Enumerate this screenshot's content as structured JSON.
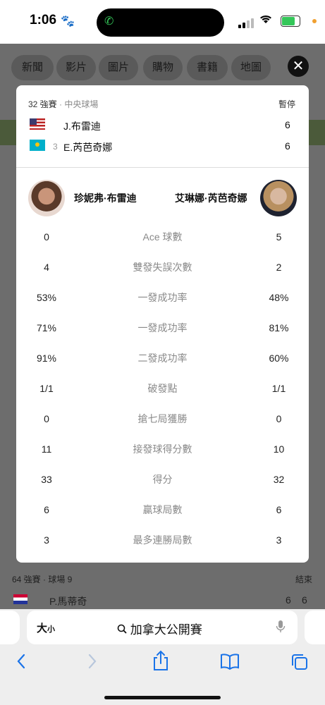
{
  "status_bar": {
    "time": "1:06"
  },
  "background": {
    "chips": [
      "新聞",
      "影片",
      "圖片",
      "購物",
      "書籍",
      "地圖"
    ],
    "row_round": "64 強賽 · 球場 9",
    "row_status": "結束",
    "row_player": "P.馬蒂奇",
    "row_scores": [
      "6",
      "6"
    ]
  },
  "match": {
    "round": "32 強賽",
    "court": "· 中央球場",
    "status": "暫停",
    "players": [
      {
        "name": "J.布雷迪",
        "seed": "",
        "score": "6"
      },
      {
        "name": "E.芮芭奇娜",
        "seed": "3",
        "score": "6"
      }
    ]
  },
  "stats_header": {
    "left": "珍妮弗·布雷迪",
    "right": "艾琳娜·芮芭奇娜"
  },
  "stats": [
    {
      "label": "Ace 球數",
      "left": "0",
      "right": "5"
    },
    {
      "label": "雙發失誤次數",
      "left": "4",
      "right": "2"
    },
    {
      "label": "一發成功率",
      "left": "53%",
      "right": "48%"
    },
    {
      "label": "一發成功率",
      "left": "71%",
      "right": "81%"
    },
    {
      "label": "二發成功率",
      "left": "91%",
      "right": "60%"
    },
    {
      "label": "破發點",
      "left": "1/1",
      "right": "1/1"
    },
    {
      "label": "搶七局獲勝",
      "left": "0",
      "right": "0"
    },
    {
      "label": "接發球得分數",
      "left": "11",
      "right": "10"
    },
    {
      "label": "得分",
      "left": "33",
      "right": "32"
    },
    {
      "label": "贏球局數",
      "left": "6",
      "right": "6"
    },
    {
      "label": "最多連勝局數",
      "left": "3",
      "right": "3"
    }
  ],
  "browser": {
    "text_size_label": "大",
    "text_size_small": "小",
    "url_text": "加拿大公開賽"
  },
  "icons": {
    "close": "close-icon",
    "back": "chevron-left-icon",
    "forward": "chevron-right-icon",
    "share": "share-icon",
    "bookmarks": "book-icon",
    "tabs": "tabs-icon"
  }
}
